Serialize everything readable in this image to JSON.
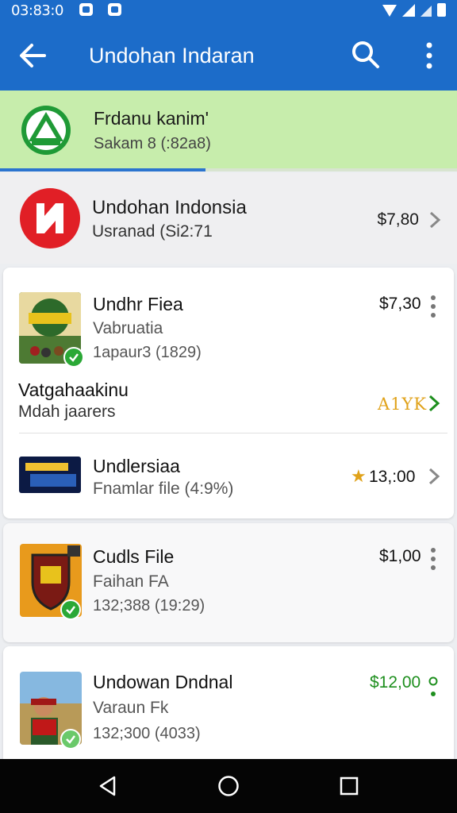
{
  "status_bar": {
    "time": "03:83:0"
  },
  "app_bar": {
    "title": "Undohan Indaran"
  },
  "banner": {
    "title": "Frdanu kanim'",
    "subtitle": "Sakam 8 (:82a8)",
    "progress": 0.45
  },
  "featured": {
    "name": "Undohan Indonsia",
    "subtitle": "Usranad (Si2:71",
    "price": "$7,80"
  },
  "items": [
    {
      "name": "Undhr Fiea",
      "subtitle": "Vabruatia",
      "meta": "1apaur3 (1829)",
      "price": "$7,30"
    },
    {
      "name": "Vatgahaakinu",
      "subtitle": "Mdah jaarers",
      "price": "A1YK"
    },
    {
      "name": "Undlersiaa",
      "subtitle": "Fnamlar file (4:9%)",
      "price": "13,:00"
    },
    {
      "name": "Cudls File",
      "subtitle": "Faihan FA",
      "meta": "132;388 (19:29)",
      "price": "$1,00"
    },
    {
      "name": "Undowan Dndnal",
      "subtitle": "Varaun Fk",
      "meta": "132;300 (4033)",
      "price": "$12,00"
    }
  ],
  "colors": {
    "primary": "#1c6cc9",
    "banner_bg": "#c7edac",
    "accent_green": "#2aa836",
    "price_gold": "#e0a21a",
    "price_green": "#1e8f1e"
  },
  "icons": [
    "back-arrow-icon",
    "search-icon",
    "more-vert-icon",
    "chevron-right-icon",
    "star-icon",
    "nav-back-icon",
    "nav-home-icon",
    "nav-recents-icon"
  ]
}
